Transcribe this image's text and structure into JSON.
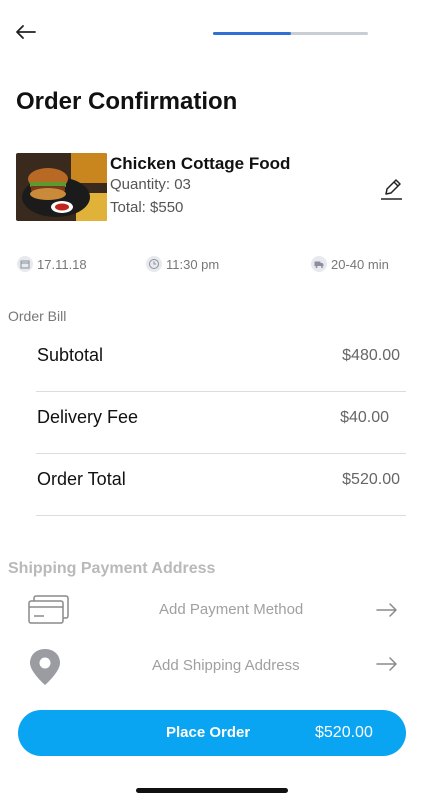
{
  "header": {
    "title": "Order Confirmation",
    "progress_fraction": 0.5
  },
  "item": {
    "name": "Chicken Cottage Food",
    "quantity": "Quantity: 03",
    "total": "Total: $550"
  },
  "meta": {
    "date": "17.11.18",
    "time": "11:30 pm",
    "delivery_window": "20-40 min"
  },
  "bill": {
    "section_label": "Order Bill",
    "rows": [
      {
        "label": "Subtotal",
        "value": "$480.00"
      },
      {
        "label": "Delivery Fee",
        "value": "$40.00"
      },
      {
        "label": "Order Total",
        "value": "$520.00"
      }
    ]
  },
  "shipping": {
    "title": "Shipping Payment Address",
    "payment_label": "Add Payment Method",
    "address_label": "Add Shipping Address"
  },
  "cta": {
    "label": "Place Order",
    "amount": "$520.00"
  },
  "colors": {
    "accent": "#0aa5f2",
    "progress": "#2f6fd6"
  },
  "icons": [
    "back-arrow-icon",
    "edit-icon",
    "calendar-icon",
    "clock-icon",
    "truck-icon",
    "card-icon",
    "location-pin-icon",
    "arrow-right-icon"
  ]
}
